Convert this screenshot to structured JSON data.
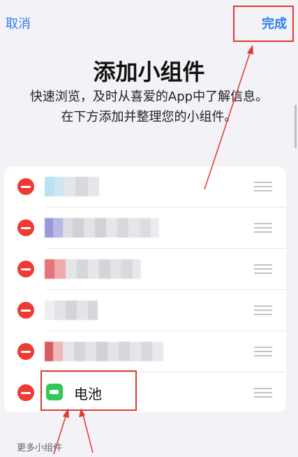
{
  "header": {
    "cancel_label": "取消",
    "done_label": "完成"
  },
  "title": "添加小组件",
  "description": "快速浏览，及时从喜爱的App中了解信息。在下方添加并整理您的小组件。",
  "widgets": [
    {
      "label": "",
      "blurred": true
    },
    {
      "label": "",
      "blurred": true
    },
    {
      "label": "",
      "blurred": true
    },
    {
      "label": "",
      "blurred": true
    },
    {
      "label": "",
      "blurred": true
    },
    {
      "label": "电池",
      "blurred": false
    }
  ],
  "footer": {
    "more_widgets": "更多小组件"
  },
  "colors": {
    "accent": "#2f7ff0",
    "remove": "#ef3a33",
    "battery": "#34c759",
    "annotation": "#e03a2e"
  }
}
